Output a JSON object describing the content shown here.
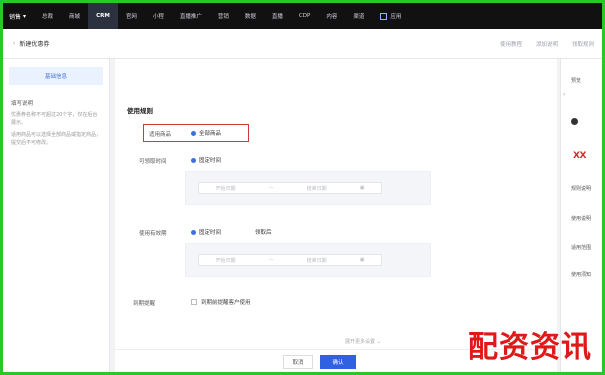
{
  "topbar": {
    "brand": "销售",
    "items": [
      "总裁",
      "商城",
      "CRM",
      "官网",
      "小程",
      "直播推广",
      "营销",
      "数据",
      "直播",
      "CDP",
      "内容",
      "渠道"
    ],
    "active_index": 2,
    "apps_label": "应用"
  },
  "subheader": {
    "title": "新建优惠券",
    "right_links": [
      "使用教程",
      "添加说明",
      "领取规则"
    ]
  },
  "left_panel": {
    "tab_label": "基础信息",
    "guide_title": "填写说明",
    "guide_items": [
      "优惠券名称不可超过20个字，仅在后台展示。",
      "适用商品可以选择全部商品或指定商品，提交后不可修改。"
    ]
  },
  "main": {
    "section_title": "使用规则",
    "rows": [
      {
        "label": "适用商品",
        "option": "全部商品"
      },
      {
        "label": "可领取时间",
        "option": "固定时间"
      },
      {
        "label": "使用有效期",
        "option": "固定时间",
        "option2": "领取后"
      }
    ],
    "range1": {
      "start_placeholder": "开始日期",
      "end_placeholder": "结束日期"
    },
    "range2": {
      "start_placeholder": "开始日期",
      "end_placeholder": "结束日期"
    },
    "notice_label": "到期提醒",
    "notice_checkbox": "到期前提醒客户使用",
    "expand_label": "展开更多设置"
  },
  "footer": {
    "cancel_label": "取消",
    "ok_label": "确认"
  },
  "right_panel": {
    "lines": [
      "预览",
      "规则说明",
      "使用说明",
      "适用范围",
      "使用须知"
    ],
    "logo": "XX"
  },
  "watermark": "配资资讯",
  "colors": {
    "accent": "#2f62e0",
    "highlight": "#d23a3a",
    "topbar": "#111111",
    "border_frame": "#2cc52c"
  }
}
